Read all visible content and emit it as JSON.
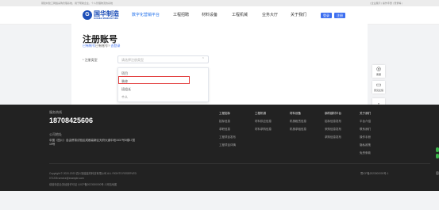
{
  "topbar": {
    "left": "钢建材建工网络采购管理系统、用于帮助企业、个人管理物流的系统",
    "right": "| 企业展示 | 操作手册 | 登录等 |"
  },
  "logo": {
    "mark": "G",
    "name": "国华制造",
    "sub": "GUOHUA MANUFACTURE"
  },
  "nav": [
    "数字化营销平台",
    "工程招聘",
    "材料设备",
    "工程机械",
    "业务大厅",
    "关于我们"
  ],
  "header_buttons": [
    "登录",
    "注册"
  ],
  "form": {
    "title": "注册账号",
    "subtitle_link": "已有帐号",
    "subtitle_text": "已有账号?",
    "subtitle_login": "去登录",
    "type_label": "* 注册类型",
    "type_placeholder": "请选择注册类型",
    "options": [
      "项目",
      "装修",
      "班组长",
      "个人"
    ]
  },
  "side_tools": [
    {
      "icon": "wechat-icon",
      "glyph": "◎",
      "label": "客服"
    },
    {
      "icon": "document-icon",
      "glyph": "▭",
      "label": "意见反馈"
    },
    {
      "icon": "back-to-top-icon",
      "glyph": "↑",
      "label": ""
    }
  ],
  "footer": {
    "hotline_label": "服务热线",
    "phone": "18708425606",
    "address_label": "公司地址",
    "address": "中国（四川）自由贸易试验区成都高新区天府大道中段1537号3幢17层19号",
    "columns": [
      {
        "heading": "工程招标",
        "items": [
          "招标信息",
          "求职信息",
          "工程项目发布",
          "工程项目详情"
        ]
      },
      {
        "heading": "工程机械",
        "items": [
          "材料供应信息",
          "材料求购信息"
        ]
      },
      {
        "heading": "材料设备",
        "items": [
          "机械租赁信息",
          "机械求租信息"
        ]
      },
      {
        "heading": "钢材建材平台",
        "items": [
          "招标信息发布",
          "采购信息发布",
          "求购信息发布"
        ]
      },
      {
        "heading": "关于我们",
        "items": [
          "平台介绍",
          "联系我们",
          "操作手册",
          "隐私政策",
          "免责条款"
        ]
      }
    ],
    "copyright": "Copyright © 2020-2023 四川钢建建材科技有限公司 ALL RIGHTS RESERVED",
    "email": "071235    service@example.com",
    "icp_line": "增值电信业务经营许可证   川ICP备2023000000号-1   网站地图",
    "icp_right": "蜀ICP备2023000000号-1"
  },
  "colors": {
    "accent": "#3d6ff0",
    "footer_bg": "#222222",
    "highlight": "#e23d3d"
  }
}
